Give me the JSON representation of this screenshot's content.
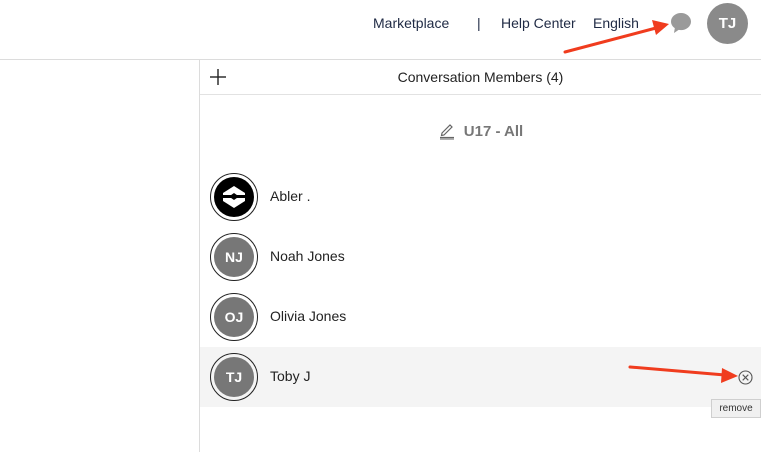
{
  "header": {
    "links": [
      "Marketplace",
      "Help Center",
      "English"
    ],
    "separator": "|",
    "user_initials": "TJ"
  },
  "members_panel": {
    "title": "Conversation Members (4)",
    "group_name": "U17 - All",
    "members": [
      {
        "name": "Abler .",
        "initials": ""
      },
      {
        "name": "Noah Jones",
        "initials": "NJ"
      },
      {
        "name": "Olivia Jones",
        "initials": "OJ"
      },
      {
        "name": "Toby J",
        "initials": "TJ"
      }
    ],
    "remove_tooltip": "remove"
  },
  "colors": {
    "annotation_arrow": "#f03c1e",
    "avatar_bg": "#777777"
  },
  "icons": [
    "chat-bubble-icon",
    "plus-icon",
    "edit-pen-icon",
    "remove-circle-x-icon",
    "abler-logo-icon"
  ]
}
